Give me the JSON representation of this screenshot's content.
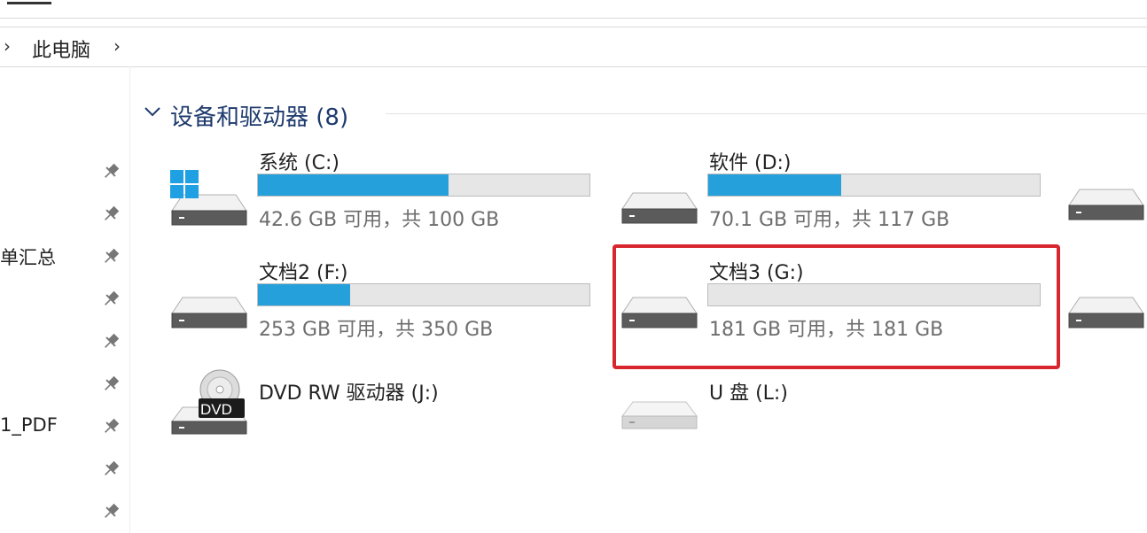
{
  "address": {
    "chevron_left": "›",
    "crumb": "此电脑",
    "chevron_right": "›"
  },
  "sidebar": {
    "labels": [
      "单汇总",
      "1_PDF"
    ],
    "pins": 9
  },
  "group": {
    "title": "设备和驱动器 (8)"
  },
  "drives": [
    {
      "name": "系统 (C:)",
      "capacity": "42.6 GB 可用，共 100 GB",
      "used_fraction": 0.574,
      "icon": "windows-drive-icon"
    },
    {
      "name": "软件 (D:)",
      "capacity": "70.1 GB 可用，共 117 GB",
      "used_fraction": 0.4,
      "icon": "drive-icon"
    },
    {
      "name": "文档2 (F:)",
      "capacity": "253 GB 可用，共 350 GB",
      "used_fraction": 0.277,
      "icon": "drive-icon"
    },
    {
      "name": "文档3 (G:)",
      "capacity": "181 GB 可用，共 181 GB",
      "used_fraction": 0.0,
      "icon": "drive-icon"
    },
    {
      "name": "DVD RW 驱动器 (J:)",
      "dvd_label": "DVD",
      "icon": "dvd-drive-icon"
    },
    {
      "name": "U 盘 (L:)",
      "icon": "usb-drive-icon"
    }
  ],
  "colors": {
    "accent": "#26a0da",
    "highlight": "#d7262e",
    "group_title": "#1e3a6d"
  }
}
